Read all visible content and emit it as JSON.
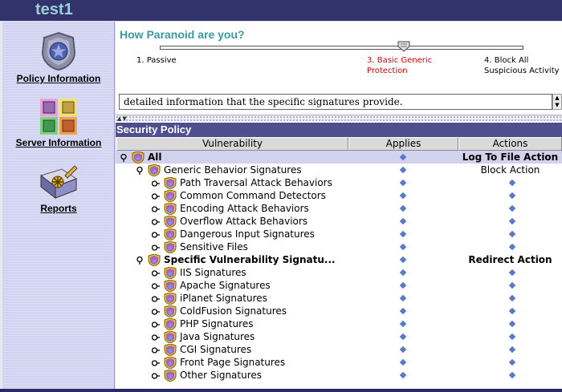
{
  "window": {
    "title": "test1"
  },
  "sidebar": {
    "items": [
      {
        "label": "Policy Information",
        "icon": "police-badge-icon"
      },
      {
        "label": "Server Information",
        "icon": "servers-icon"
      },
      {
        "label": "Reports",
        "icon": "reports-icon"
      }
    ]
  },
  "paranoia": {
    "title": "How Paranoid are you?",
    "levels": [
      {
        "label": "1. Passive"
      },
      {
        "label": "3. Basic Generic\nProtection",
        "selected": true
      },
      {
        "label": "4. Block All\nSuspicious Activity"
      }
    ],
    "current_level": 3
  },
  "description": {
    "text": "detailed information that the specific signatures provide."
  },
  "policy": {
    "title": "Security Policy",
    "columns": [
      "Vulnerability",
      "Applies",
      "Actions"
    ],
    "rows": [
      {
        "name": "All",
        "level": 0,
        "bold": true,
        "action": "Log To File Action",
        "action_bold": true
      },
      {
        "name": "Generic Behavior Signatures",
        "level": 1,
        "bold": false,
        "action": "Block Action",
        "action_bold": false
      },
      {
        "name": "Path Traversal Attack Behaviors",
        "level": 2
      },
      {
        "name": "Common Command Detectors",
        "level": 2
      },
      {
        "name": "Encoding Attack Behaviors",
        "level": 2
      },
      {
        "name": "Overflow Attack Behaviors",
        "level": 2
      },
      {
        "name": "Dangerous Input Signatures",
        "level": 2
      },
      {
        "name": "Sensitive Files",
        "level": 2
      },
      {
        "name": "Specific Vulnerability Signatu...",
        "level": 1,
        "bold": true,
        "action": "Redirect Action",
        "action_bold": true
      },
      {
        "name": "IIS Signatures",
        "level": 2
      },
      {
        "name": "Apache Signatures",
        "level": 2
      },
      {
        "name": "iPlanet Signatures",
        "level": 2
      },
      {
        "name": "ColdFusion Signatures",
        "level": 2
      },
      {
        "name": "PHP Signatures",
        "level": 2
      },
      {
        "name": "Java Signatures",
        "level": 2
      },
      {
        "name": "CGI Signatures",
        "level": 2
      },
      {
        "name": "Front Page Signatures",
        "level": 2
      },
      {
        "name": "Other Signatures",
        "level": 2
      }
    ]
  },
  "colors": {
    "titlebar": "#33336b",
    "title_text": "#9ad0d6",
    "accent": "#3a9aa0",
    "selected_level": "#dd0000",
    "header": "#4f4f8f"
  }
}
